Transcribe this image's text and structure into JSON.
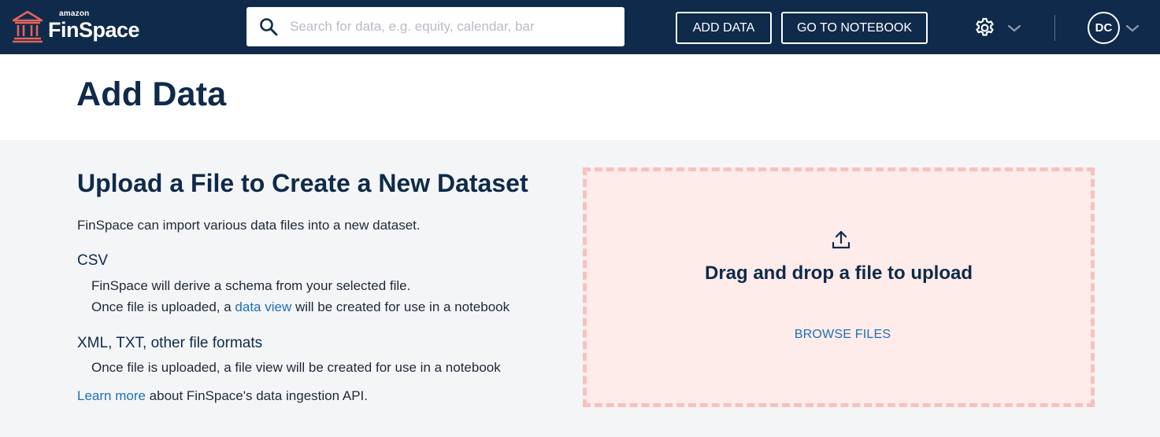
{
  "navbar": {
    "logo_top": "amazon",
    "logo_main": "FinSpace",
    "search_placeholder": "Search for data, e.g. equity, calendar, bar",
    "add_data_label": "ADD DATA",
    "go_notebook_label": "GO TO NOTEBOOK",
    "avatar_initials": "DC",
    "icons": [
      "bank-icon",
      "search-icon",
      "gear-icon",
      "chevron-down-icon"
    ],
    "colors": {
      "background": "#0f2a4a",
      "logo_accent": "#e5645a"
    }
  },
  "page": {
    "title": "Add Data"
  },
  "upload": {
    "heading": "Upload a File to Create a New Dataset",
    "intro": "FinSpace can import various data files into a new dataset.",
    "csv": {
      "title": "CSV",
      "line1": "FinSpace will derive a schema from your selected file.",
      "line2_prefix": "Once file is uploaded, a ",
      "line2_link": "data view",
      "line2_suffix": " will be created for use in a notebook"
    },
    "other": {
      "title": "XML, TXT, other file formats",
      "line1": "Once file is uploaded, a file view will be created for use in a notebook"
    },
    "learn_more_link": "Learn more",
    "learn_more_suffix": " about FinSpace's data ingestion API."
  },
  "dropzone": {
    "icon": "upload-icon",
    "title": "Drag and drop a file to upload",
    "browse_label": "BROWSE FILES",
    "colors": {
      "background": "#fdecea",
      "border": "#f6c2bd",
      "link": "#1f6fb5"
    }
  }
}
